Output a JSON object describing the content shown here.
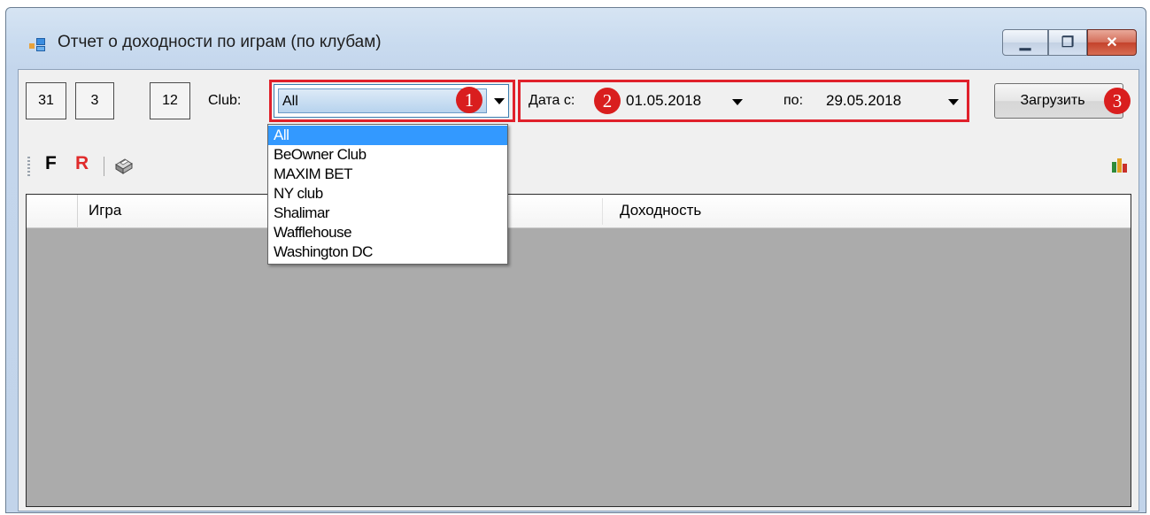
{
  "window": {
    "title": "Отчет о доходности по играм (по клубам)",
    "caption_buttons": {
      "minimize": "▁",
      "maximize": "❐",
      "close": "✕"
    }
  },
  "filters": {
    "num_boxes": [
      "31",
      "3",
      "12"
    ],
    "club_label": "Club:",
    "club_selected": "All",
    "date_from_label": "Дата с:",
    "date_from": "01.05.2018",
    "date_to_label": "по:",
    "date_to": "29.05.2018",
    "load_button": "Загрузить"
  },
  "badges": [
    "1",
    "2",
    "3"
  ],
  "club_dropdown": {
    "options": [
      "All",
      "BeOwner Club",
      "MAXIM BET",
      "NY club",
      "Shalimar",
      "Wafflehouse",
      "Washington DC"
    ],
    "selected_index": 0
  },
  "toolbar": {
    "f_label": "F",
    "r_label": "R"
  },
  "grid": {
    "columns": [
      "Игра",
      "Доходность"
    ]
  },
  "colors": {
    "highlight": "#e0212b",
    "badge": "#d91e1e",
    "selection": "#3399ff",
    "grid_bg": "#ababab"
  }
}
